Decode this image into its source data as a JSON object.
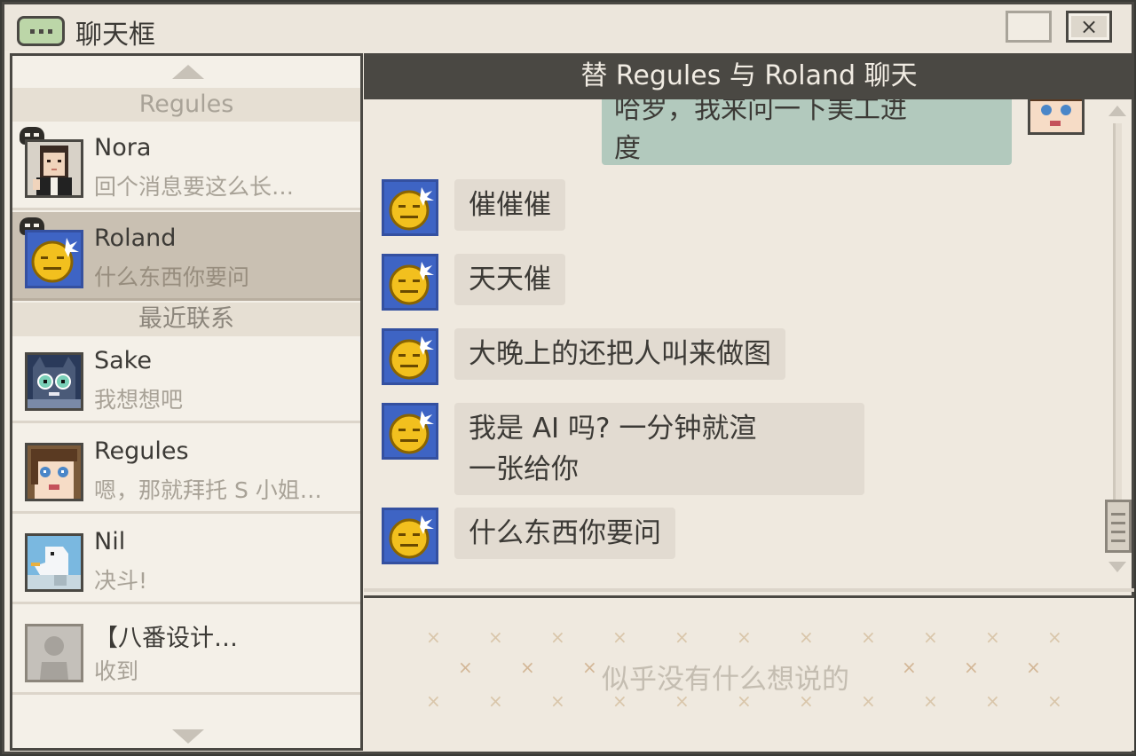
{
  "window": {
    "title": "聊天框",
    "close_label": "×"
  },
  "sidebar": {
    "section_pinned": "Regules",
    "section_recent": "最近联系",
    "contacts": [
      {
        "name": "Nora",
        "preview": "回个消息要这么长…"
      },
      {
        "name": "Roland",
        "preview": "什么东西你要问"
      },
      {
        "name": "Sake",
        "preview": "我想想吧"
      },
      {
        "name": "Regules",
        "preview": "嗯，那就拜托 S 小姐…"
      },
      {
        "name": "Nil",
        "preview": "决斗!"
      },
      {
        "name": "【八番设计…",
        "preview": "收到"
      }
    ]
  },
  "chat": {
    "header": "替 Regules 与 Roland 聊天",
    "outgoing": {
      "line1": "哈罗，我来问一下美工进",
      "line2": "度"
    },
    "messages": [
      {
        "text": "催催催"
      },
      {
        "text": "天天催"
      },
      {
        "text": "大晚上的还把人叫来做图"
      },
      {
        "line1": "我是 AI 吗? 一分钟就渲",
        "line2": "一张给你"
      },
      {
        "text": "什么东西你要问"
      }
    ]
  },
  "input": {
    "placeholder": "似乎没有什么想说的"
  },
  "colors": {
    "frame": "#4a4843",
    "header_bg": "#4a4843",
    "outgoing_bubble": "#b2c9bd",
    "incoming_bubble": "#e2dbd1",
    "active_contact": "#c9c0b2",
    "emoji_blue": "#3e64c4",
    "emoji_yellow": "#f2c01e"
  }
}
